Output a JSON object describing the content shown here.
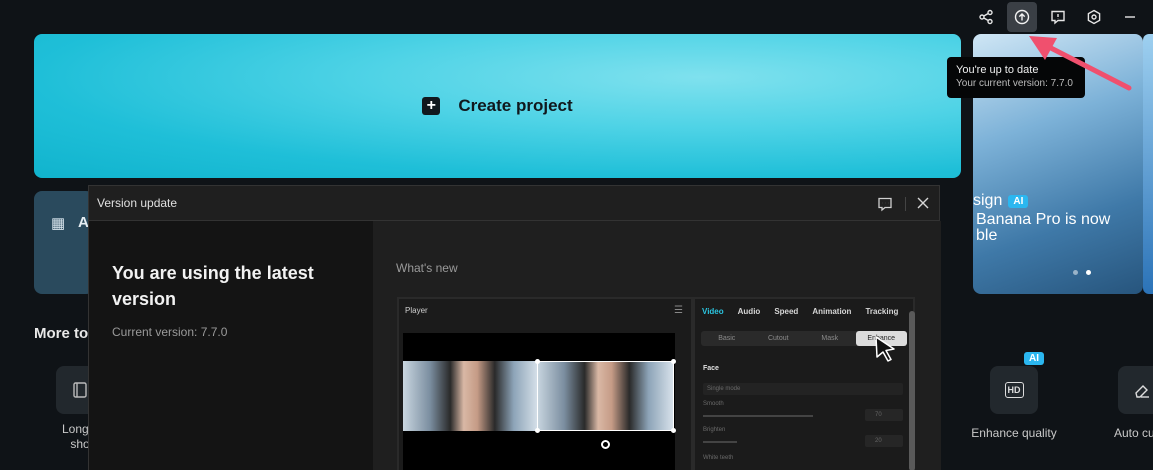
{
  "hero": {
    "label": "Create project"
  },
  "tooltip": {
    "line1": "You're up to date",
    "line2": "Your current version: 7.7.0"
  },
  "promo": {
    "title_fragment": "sign",
    "ai_badge": "AI",
    "text_line1": "Banana Pro is now",
    "text_line2": "ble"
  },
  "card2": {
    "label_fragment": "A"
  },
  "more_tools": {
    "label": "More to"
  },
  "tools": [
    {
      "label_line1": "Long v",
      "label_line2": "sho"
    },
    {
      "label": "Enhance quality",
      "ai_badge": "AI",
      "icon_text": "HD"
    },
    {
      "label": "Auto cu"
    }
  ],
  "dialog": {
    "title": "Version update",
    "heading": "You are using the latest version",
    "current_version": "Current version: 7.7.0",
    "whats_new": "What's new",
    "preview": {
      "player_label": "Player",
      "tabs": [
        "Video",
        "Audio",
        "Speed",
        "Animation",
        "Tracking"
      ],
      "subtabs": [
        "Basic",
        "Cutout",
        "Mask",
        "Enhance"
      ],
      "face_label": "Face",
      "mode": "Single mode",
      "rows": [
        "Smooth",
        "Brighten",
        "White teeth"
      ],
      "values": [
        "70",
        "20"
      ]
    }
  },
  "colors": {
    "accent": "#2bc5e0",
    "ai_badge": "#2bb7f0",
    "arrow": "#f0506e"
  }
}
